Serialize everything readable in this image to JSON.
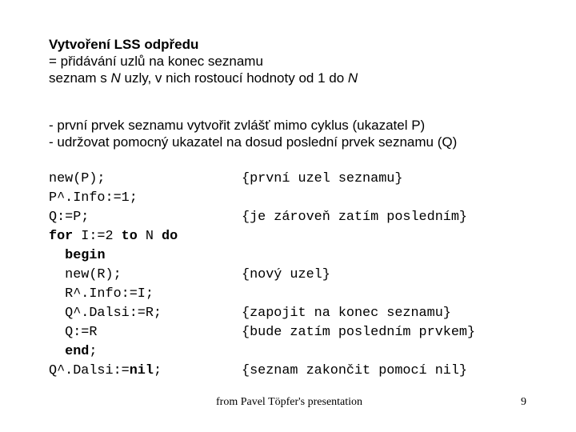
{
  "slide": {
    "title": "Vytvoření LSS odpředu",
    "subtitle_line1": "= přidávání uzlů na konec seznamu",
    "subtitle_line2_pre": "seznam s ",
    "subtitle_line2_n1": "N",
    "subtitle_line2_mid": " uzly, v nich rostoucí hodnoty od 1 do ",
    "subtitle_line2_n2": "N",
    "bullets": [
      "- první prvek seznamu vytvořit zvlášť mimo cyklus (ukazatel P)",
      "- udržovat pomocný ukazatel na dosud poslední prvek seznamu (Q)"
    ],
    "code": {
      "l1": "new(P);",
      "l2": "P^.Info:=1;",
      "l3": "Q:=P;",
      "l4_kw1": "for",
      "l4_mid1": " I:=2 ",
      "l4_kw2": "to",
      "l4_mid2": " N ",
      "l4_kw3": "do",
      "l5_indent": "  ",
      "l5_kw": "begin",
      "l6": "  new(R);",
      "l7": "  R^.Info:=I;",
      "l8": "  Q^.Dalsi:=R;",
      "l9": "  Q:=R",
      "l10_indent": "  ",
      "l10_kw": "end",
      "l10_tail": ";",
      "l11_pre": "Q^.Dalsi:=",
      "l11_kw": "nil",
      "l11_tail": ";"
    },
    "comments": {
      "c1": "{první uzel seznamu}",
      "c3": "{je zároveň zatím posledním}",
      "c6": "{nový uzel}",
      "c8": "{zapojit na konec seznamu}",
      "c9": "{bude zatím posledním prvkem}",
      "c11": "{seznam zakončit pomocí nil}"
    },
    "footer": {
      "source": "from Pavel  Töpfer's presentation",
      "page_number": "9"
    }
  }
}
